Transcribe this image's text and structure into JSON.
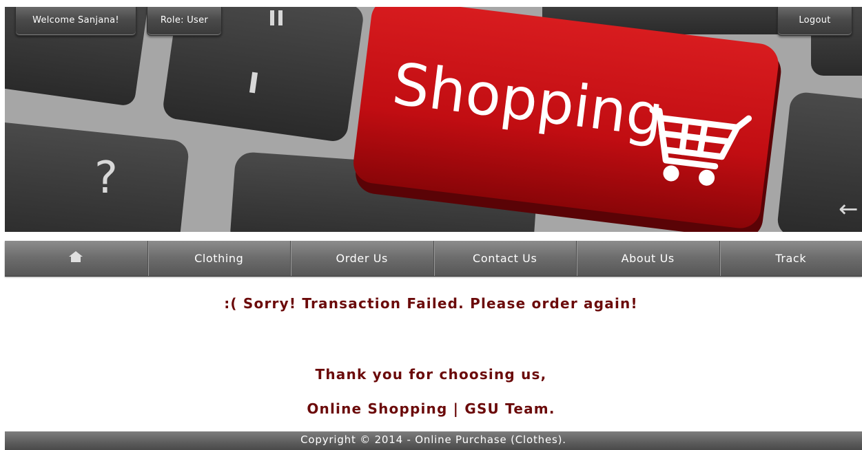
{
  "header": {
    "welcome_label": "Welcome Sanjana!",
    "role_label": "Role: User",
    "logout_label": "Logout"
  },
  "banner": {
    "key_text": "Shopping",
    "key_glyph_question": "?",
    "key_color": "#c50d12",
    "cart_icon": "shopping-cart-icon"
  },
  "nav": {
    "home_icon": "home-icon",
    "items": [
      "Clothing",
      "Order Us",
      "Contact Us",
      "About Us",
      "Track"
    ]
  },
  "main": {
    "failure_message": ":( Sorry! Transaction Failed. Please order again!",
    "thanks_line": "Thank you for choosing us,",
    "team_line": "Online Shopping | GSU Team.",
    "text_color": "#6b0a0a"
  },
  "footer": {
    "copyright": "Copyright © 2014 - Online Purchase (Clothes)."
  }
}
